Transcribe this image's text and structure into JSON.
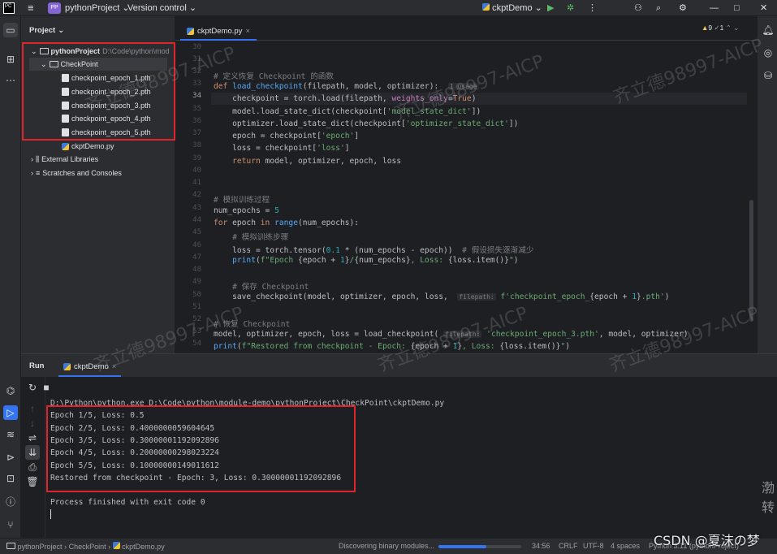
{
  "titlebar": {
    "app_badge": "PP",
    "project_name": "pythonProject",
    "vcs_label": "Version control",
    "run_config": "ckptDemo"
  },
  "project_panel": {
    "title": "Project",
    "root_name": "pythonProject",
    "root_path": "D:\\Code\\python\\mod",
    "folder": "CheckPoint",
    "files": [
      "checkpoint_epoch_1.pth",
      "checkpoint_epoch_2.pth",
      "checkpoint_epoch_3.pth",
      "checkpoint_epoch_4.pth",
      "checkpoint_epoch_5.pth"
    ],
    "script": "ckptDemo.py",
    "external": "External Libraries",
    "scratches": "Scratches and Consoles"
  },
  "editor": {
    "tab_label": "ckptDemo.py",
    "inspection_warnings": "9",
    "inspection_weak": "1",
    "line_numbers": [
      "30",
      "31",
      "32",
      "33",
      "34",
      "35",
      "36",
      "37",
      "38",
      "39",
      "40",
      "41",
      "42",
      "43",
      "44",
      "45",
      "46",
      "47",
      "48",
      "49",
      "50",
      "51",
      "52",
      "53",
      "54"
    ]
  },
  "run_panel": {
    "title": "Run",
    "tab_label": "ckptDemo",
    "command": "D:\\Python\\python.exe D:\\Code\\python\\module-demo\\pythonProject\\CheckPoint\\ckptDemo.py",
    "output": [
      "Epoch 1/5, Loss: 0.5",
      "Epoch 2/5, Loss: 0.4000000059604645",
      "Epoch 3/5, Loss: 0.30000001192092896",
      "Epoch 4/5, Loss: 0.20000000298023224",
      "Epoch 5/5, Loss: 0.10000000149011612",
      "Restored from checkpoint - Epoch: 3, Loss: 0.30000001192092896"
    ],
    "finished": "Process finished with exit code 0"
  },
  "statusbar": {
    "crumb_project": "pythonProject",
    "crumb_folder": "CheckPoint",
    "crumb_file": "ckptDemo.py",
    "task": "Discovering binary modules...",
    "position": "34:56",
    "line_sep": "CRLF",
    "encoding": "UTF-8",
    "indent": "4 spaces",
    "interpreter": "Python 3.11 (pythonProject)"
  },
  "overlay": {
    "watermark": "齐立德98997-AICP",
    "csdn": "CSDN @夏沫の梦",
    "side_chars": "渤\n转"
  }
}
